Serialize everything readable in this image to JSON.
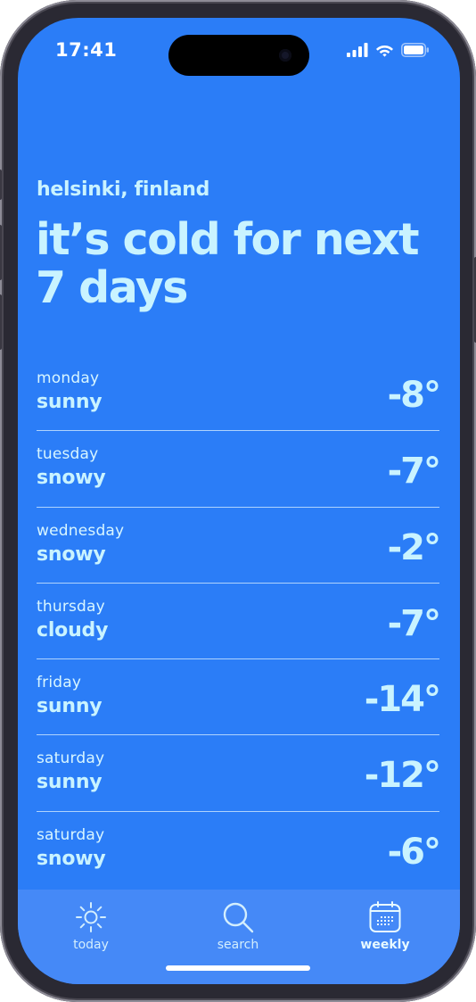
{
  "status_bar": {
    "time": "17:41"
  },
  "header": {
    "location": "helsinki, finland",
    "headline": "it’s cold for next 7 days"
  },
  "forecast": [
    {
      "day": "monday",
      "condition": "sunny",
      "temp": "-8°"
    },
    {
      "day": "tuesday",
      "condition": "snowy",
      "temp": "-7°"
    },
    {
      "day": "wednesday",
      "condition": "snowy",
      "temp": "-2°"
    },
    {
      "day": "thursday",
      "condition": "cloudy",
      "temp": "-7°"
    },
    {
      "day": "friday",
      "condition": "sunny",
      "temp": "-14°"
    },
    {
      "day": "saturday",
      "condition": "sunny",
      "temp": "-12°"
    },
    {
      "day": "saturday",
      "condition": "snowy",
      "temp": "-6°"
    }
  ],
  "tab_bar": {
    "tabs": [
      {
        "label": "today",
        "icon": "sun-icon",
        "active": false
      },
      {
        "label": "search",
        "icon": "magnifier-icon",
        "active": false
      },
      {
        "label": "weekly",
        "icon": "calendar-icon",
        "active": true
      }
    ]
  },
  "colors": {
    "background": "#2b7df7",
    "tab_bar": "#4589f7",
    "text": "#c9f3ff",
    "divider": "#dcf0ff"
  }
}
